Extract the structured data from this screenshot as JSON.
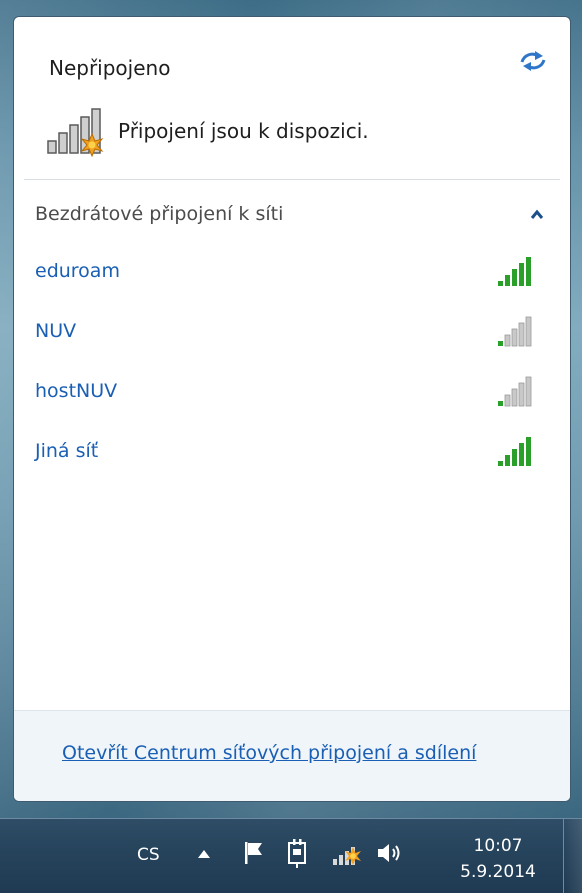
{
  "flyout": {
    "status_title": "Nepřipojeno",
    "status_message": "Připojení jsou k dispozici.",
    "section_header": "Bezdrátové připojení k síti",
    "networks": [
      {
        "name": "eduroam",
        "signal_bars": 5,
        "signal_color": "#2aa02a"
      },
      {
        "name": "NUV",
        "signal_bars": 1,
        "signal_color": "#2aa02a"
      },
      {
        "name": "hostNUV",
        "signal_bars": 1,
        "signal_color": "#2aa02a"
      },
      {
        "name": "Jiná síť",
        "signal_bars": 5,
        "signal_color": "#2aa02a"
      }
    ],
    "footer_link": "Otevřít Centrum síťových připojení a sdílení",
    "icons": {
      "refresh": "refresh-icon",
      "status": "network-unavailable-icon",
      "collapse": "chevron-up-icon"
    }
  },
  "taskbar": {
    "language": "CS",
    "time": "10:07",
    "date": "5.9.2014",
    "tray_icons": [
      "show-hidden-icons-arrow-icon",
      "action-center-flag-icon",
      "power-plug-icon",
      "network-status-icon",
      "volume-icon"
    ]
  },
  "colors": {
    "link": "#1a5fb4",
    "accent_chevron": "#1a4f8a",
    "warning_star": "#f0a020"
  }
}
